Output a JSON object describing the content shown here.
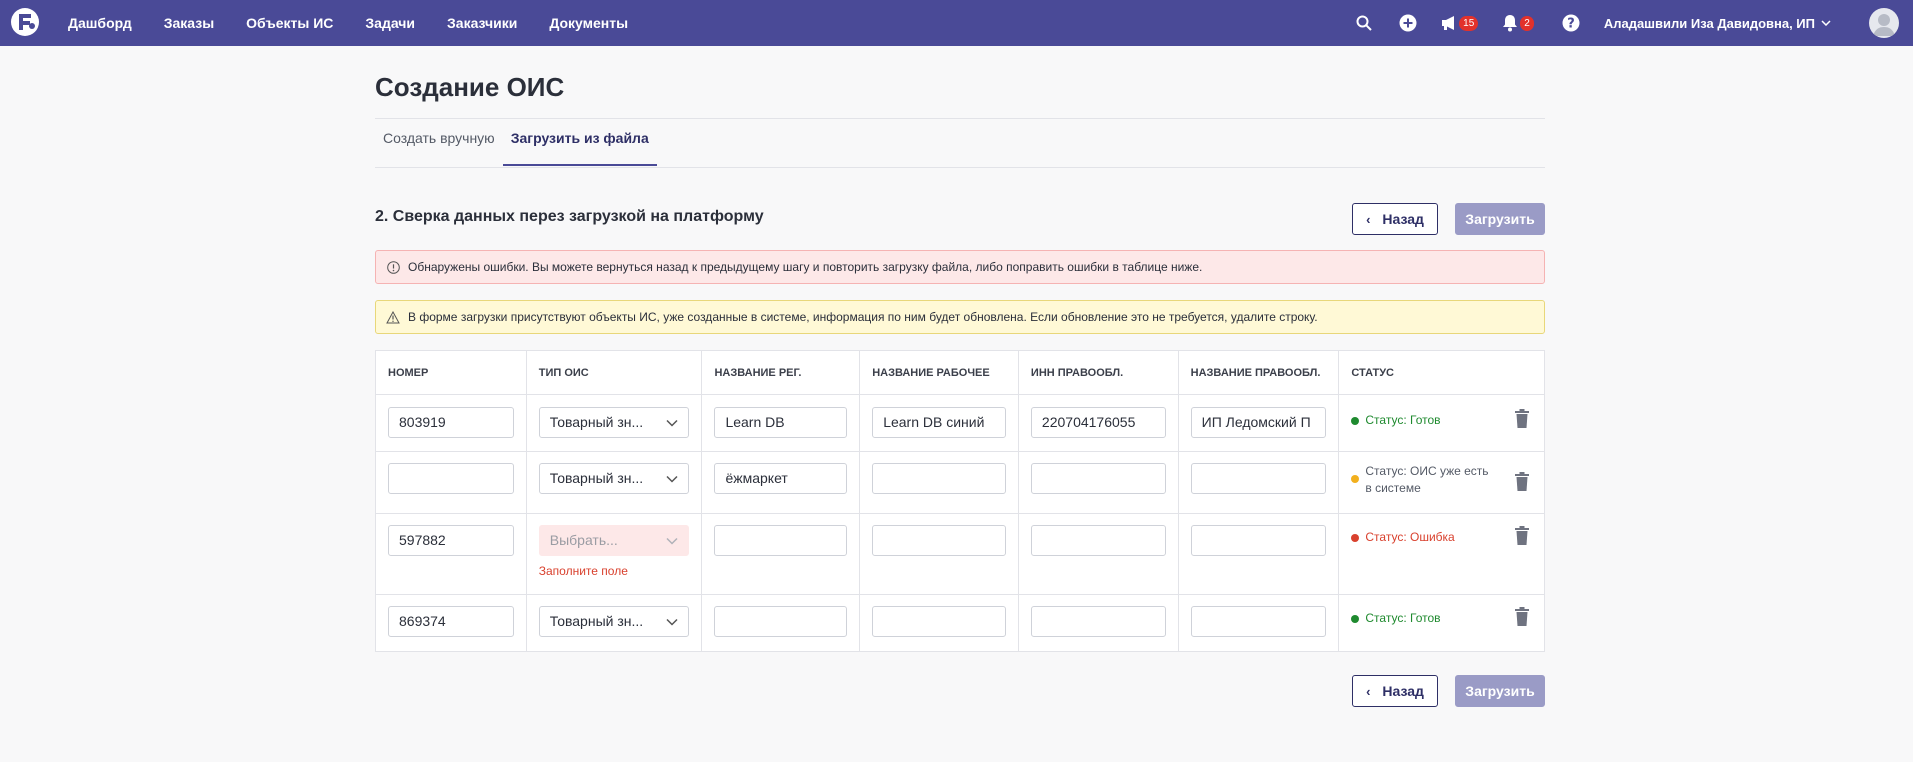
{
  "nav": {
    "links": [
      "Дашборд",
      "Заказы",
      "Объекты ИС",
      "Задачи",
      "Заказчики",
      "Документы"
    ],
    "announce_count": "15",
    "notif_count": "2",
    "user_name": "Аладашвили Иза Давидовна, ИП"
  },
  "page": {
    "title": "Создание ОИС",
    "tabs": [
      "Создать вручную",
      "Загрузить из файла"
    ],
    "active_tab": "Загрузить из файла",
    "section_title": "2. Сверка данных перез загрузкой на платформу",
    "back_label": "Назад",
    "upload_label": "Загрузить",
    "error_alert": "Обнаружены ошибки. Вы можете вернуться назад к предыдущему шагу и повторить загрузку файла, либо поправить ошибки в таблице ниже.",
    "warn_alert": "В форме загрузки присутствуют объекты ИС, уже созданные в системе, информация по ним будет обновлена. Если обновление это не требуется, удалите строку."
  },
  "table": {
    "columns": [
      "НОМЕР",
      "ТИП ОИС",
      "НАЗВАНИЕ РЕГ.",
      "НАЗВАНИЕ РАБОЧЕЕ",
      "ИНН ПРАВООБЛ.",
      "НАЗВАНИЕ ПРАВООБЛ.",
      "СТАТУС"
    ],
    "rows": [
      {
        "number": "803919",
        "type": "Товарный зн...",
        "reg_name": "Learn DB",
        "work_name": "Learn DB синий",
        "inn": "220704176055",
        "owner": "ИП Ледомский П",
        "status": "Статус: Готов",
        "status_color": "#1f8a2f"
      },
      {
        "number": "",
        "type": "Товарный зн...",
        "reg_name": "ёжмаркет",
        "work_name": "",
        "inn": "",
        "owner": "",
        "status": "Статус: ОИС уже есть в системе",
        "status_color": "#f2b01e"
      },
      {
        "number": "597882",
        "type": "Выбрать...",
        "type_error": "Заполните поле",
        "reg_name": "",
        "work_name": "",
        "inn": "",
        "owner": "",
        "status": "Статус: Ошибка",
        "status_color": "#d9412e"
      },
      {
        "number": "869374",
        "type": "Товарный зн...",
        "reg_name": "",
        "work_name": "",
        "inn": "",
        "owner": "",
        "status": "Статус: Готов",
        "status_color": "#1f8a2f"
      }
    ]
  }
}
